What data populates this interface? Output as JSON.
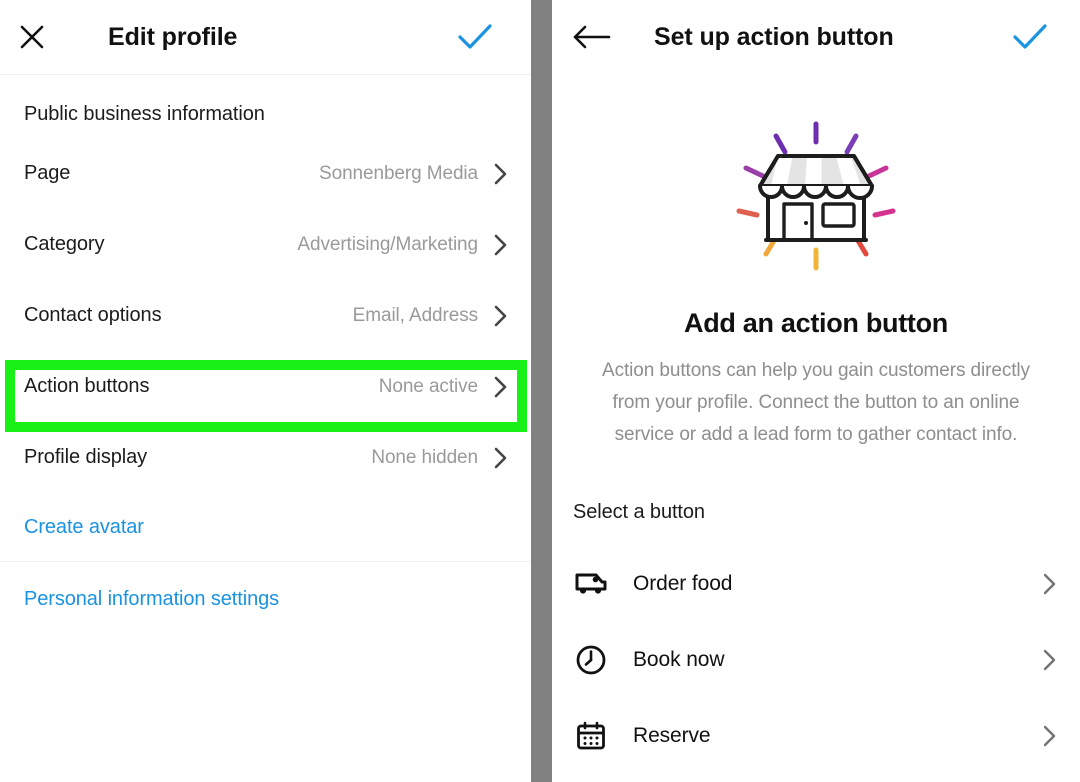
{
  "left_panel": {
    "header": {
      "close_icon": "close-icon",
      "title": "Edit profile",
      "confirm_icon": "check-icon"
    },
    "section_label": "Public business information",
    "rows": [
      {
        "label": "Page",
        "value": "Sonnenberg Media"
      },
      {
        "label": "Category",
        "value": "Advertising/Marketing"
      },
      {
        "label": "Contact options",
        "value": "Email, Address"
      },
      {
        "label": "Action buttons",
        "value": "None active"
      },
      {
        "label": "Profile display",
        "value": "None hidden"
      }
    ],
    "links": [
      {
        "label": "Create avatar"
      },
      {
        "label": "Personal information settings"
      }
    ]
  },
  "right_panel": {
    "header": {
      "back_icon": "back-arrow-icon",
      "title": "Set up action button",
      "confirm_icon": "check-icon"
    },
    "illustration": "storefront-icon",
    "hero_title": "Add an action button",
    "hero_body": "Action buttons can help you gain customers directly from your profile. Connect the button to an online service or add a lead form to gather contact info.",
    "select_label": "Select a button",
    "options": [
      {
        "label": "Order food",
        "icon": "delivery-truck-icon"
      },
      {
        "label": "Book now",
        "icon": "clock-icon"
      },
      {
        "label": "Reserve",
        "icon": "calendar-icon"
      }
    ]
  },
  "colors": {
    "accent_blue": "#1a93e0",
    "highlight_green": "#18f018",
    "divider_gray": "#818181",
    "muted_text": "#9a9a9a",
    "ray_purple": "#7b3fb5",
    "ray_magenta": "#c7359b",
    "ray_orange": "#f0a83c",
    "ray_red": "#e3493f"
  }
}
